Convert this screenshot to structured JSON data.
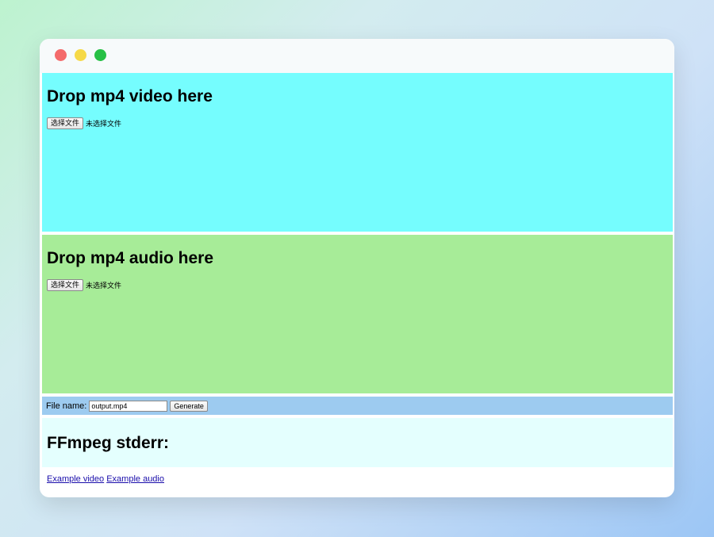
{
  "video_drop": {
    "heading": "Drop mp4 video here",
    "choose_button": "选择文件",
    "file_status": "未选择文件",
    "bg_color": "#75fdfe"
  },
  "audio_drop": {
    "heading": "Drop mp4 audio here",
    "choose_button": "选择文件",
    "file_status": "未选择文件",
    "bg_color": "#a7ec98"
  },
  "generate": {
    "label": "File name:",
    "filename_value": "output.mp4",
    "button": "Generate"
  },
  "stderr": {
    "heading": "FFmpeg stderr:"
  },
  "links": {
    "example_video": "Example video",
    "example_audio": "Example audio"
  }
}
